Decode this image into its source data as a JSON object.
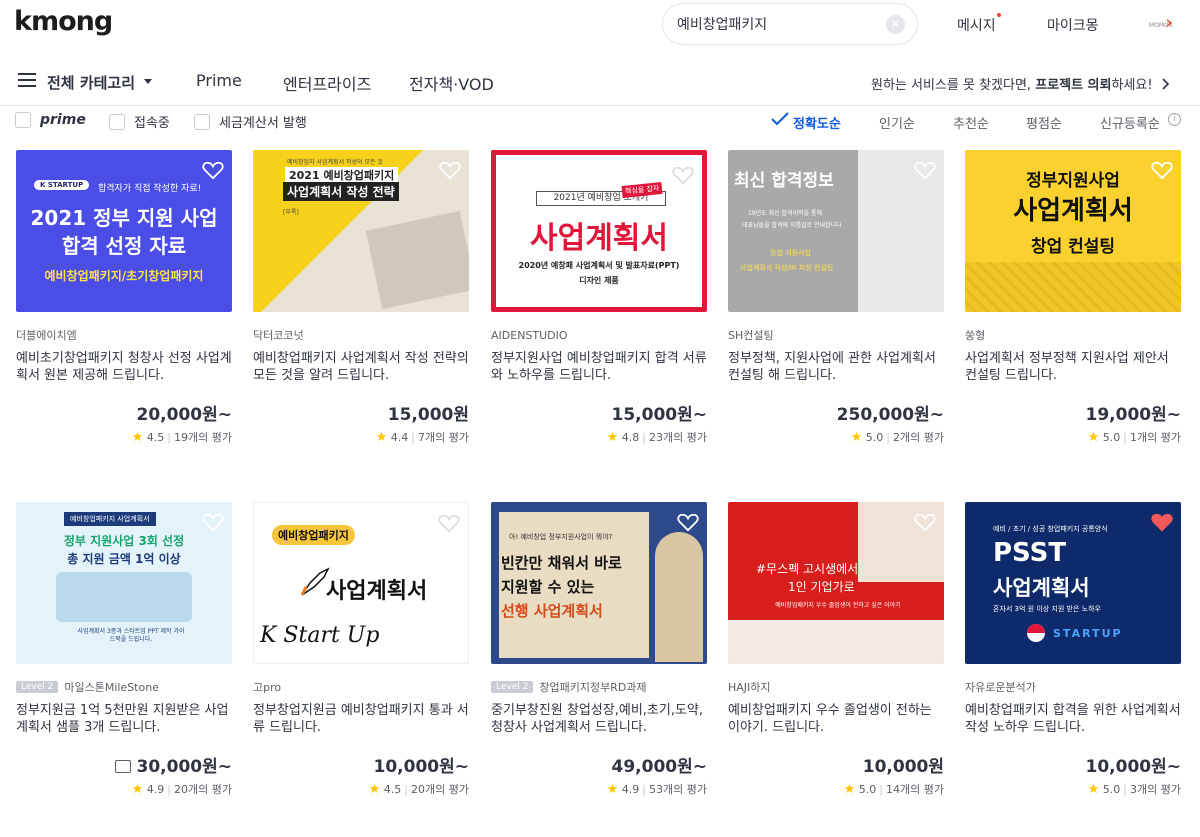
{
  "header": {
    "logo": "kmong",
    "search_value": "예비창업패키지",
    "message_label": "메시지",
    "mykmong_label": "마이크몽",
    "avatar_text": "MOMOS"
  },
  "nav": {
    "category_label": "전체 카테고리",
    "items": [
      "Prime",
      "엔터프라이즈",
      "전자책·VOD"
    ],
    "project_prefix": "원하는 서비스를 못 찾겠다면, ",
    "project_bold": "프로젝트 의뢰",
    "project_suffix": "하세요!"
  },
  "filters": {
    "prime": "prime",
    "online": "접속중",
    "tax": "세금계산서 발행"
  },
  "sort": {
    "options": [
      "정확도순",
      "인기순",
      "추천순",
      "평점순",
      "신규등록순"
    ]
  },
  "cards": [
    {
      "seller": "더블에이치엠",
      "level": "",
      "title": "예비초기창업패키지 청창사 선정 사업계획서 원본 제공해 드립니다.",
      "price": "20,000원~",
      "rating": "4.5",
      "reviews": "19개의 평가",
      "thumb": {
        "bg": "#4a4de6",
        "top": "합격자가 직접 작성한 자료!",
        "main1": "2021 정부 지원 사업",
        "main2": "합격 선정 자료",
        "sub": "예비창업패키지/초기창업패키지",
        "badge": "K STARTUP"
      }
    },
    {
      "seller": "닥터코코넛",
      "level": "",
      "title": "예비창업패키지 사업계획서 작성 전략의 모든 것을 알려 드립니다.",
      "price": "15,000원",
      "rating": "4.4",
      "reviews": "7개의 평가",
      "thumb": {
        "bg": "#f7d21b",
        "top": "예비창업자 사업계획서 작성의 모든 것",
        "main1": "2021 예비창업패키지",
        "main2": "사업계획서 작성 전략",
        "sub": "[부록]"
      }
    },
    {
      "seller": "AIDENSTUDIO",
      "level": "",
      "title": "정부지원사업 예비창업패키지 합격 서류와 노하우를 드립니다.",
      "price": "15,000원~",
      "rating": "4.8",
      "reviews": "23개의 평가",
      "thumb": {
        "bg": "#ffffff",
        "top": "2021년 예비창업 보개기",
        "main1": "사업계획서",
        "main2": "",
        "sub": "2020년 예창패 사업계획서 및 발표자료(PPT)",
        "badge": "디자인 제품",
        "tag": "핵심을 잡자"
      }
    },
    {
      "seller": "SH컨설팅",
      "level": "",
      "title": "정부정책, 지원사업에 관한 사업계획서 컨설팅 해 드립니다.",
      "price": "250,000원~",
      "rating": "5.0",
      "reviews": "2개의 평가",
      "thumb": {
        "bg": "#a9a9a9",
        "top": "최신 합격정보",
        "main1": "19년도 최신 합격이력을 통해",
        "main2": "대표님들을 합격에 지름길로 안내합니다",
        "sub": "창업 지원사업",
        "badge": "사업계획서 작성/IR 피칭 컨설팅"
      }
    },
    {
      "seller": "쑹형",
      "level": "",
      "title": "사업계획서 정부정책 지원사업 제안서 컨설팅 드립니다.",
      "price": "19,000원~",
      "rating": "5.0",
      "reviews": "1개의 평가",
      "thumb": {
        "bg": "#fbd12f",
        "top": "정부지원사업",
        "main1": "사업계획서",
        "main2": "창업 컨설팅",
        "sub": ""
      }
    },
    {
      "seller": "마일스톤MileStone",
      "level": "Level 2",
      "title": "정부지원금 1억 5천만원 지원받은 사업계획서 샘플 3개 드립니다.",
      "price": "30,000원~",
      "rating": "4.9",
      "reviews": "20개의 평가",
      "thumb": {
        "bg": "#e4f3fa",
        "top": "예비창업패키지 사업계획서",
        "main1": "정부 지원사업 3회 선정",
        "main2": "총 지원 금액 1억 이상",
        "sub": "사업계획서 3종과 스타트업 PPT 제작 가이드북을 드립니다."
      }
    },
    {
      "seller": "고pro",
      "level": "",
      "title": "정부창업지원금 예비창업패키지 통과 서류 드립니다.",
      "price": "10,000원~",
      "rating": "4.5",
      "reviews": "20개의 평가",
      "thumb": {
        "bg": "#ffffff",
        "top": "예비창업패키지",
        "main1": "사업계획서",
        "main2": "K Start Up",
        "sub": ""
      }
    },
    {
      "seller": "창업패키지정부RD과제",
      "level": "Level 2",
      "title": "중기부창진원 창업성장,예비,초기,도약,청창사 사업계획서 드립니다.",
      "price": "49,000원~",
      "rating": "4.9",
      "reviews": "53개의 평가",
      "thumb": {
        "bg": "#2f4a8a",
        "top": "아! 예비창업 정부지원사업이 뭐야?",
        "main1": "빈칸만 채워서 바로",
        "main2": "지원할 수 있는",
        "sub": "선행 사업계획서"
      }
    },
    {
      "seller": "HAJI하지",
      "level": "",
      "title": "예비창업패키지 우수 졸업생이 전하는 이야기. 드립니다.",
      "price": "10,000원",
      "rating": "5.0",
      "reviews": "14개의 평가",
      "thumb": {
        "bg": "#d81d1d",
        "top": "#무스펙 고시생에서",
        "main1": "1인 기업가로",
        "main2": "",
        "sub": "예비창업패키지 우수 졸업생이 전하고 싶은 이야기"
      }
    },
    {
      "seller": "자유로운분석가",
      "level": "",
      "title": "예비창업패키지 합격을 위한 사업계획서 작성 노하우 드립니다.",
      "price": "10,000원~",
      "rating": "5.0",
      "reviews": "3개의 평가",
      "thumb": {
        "bg": "#0e2a6b",
        "top": "예비 / 초기 / 성공 창업패키지 공통양식",
        "main1": "PSST",
        "main2": "사업계획서",
        "sub": "혼자서 3억 원 이상 지원 받은 노하우",
        "badge": "STARTUP"
      }
    }
  ]
}
